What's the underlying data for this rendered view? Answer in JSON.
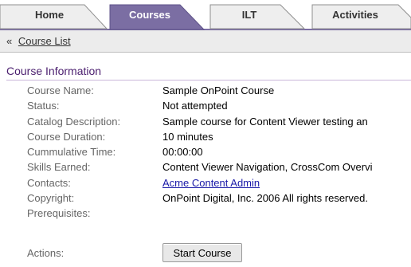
{
  "tabs": [
    {
      "label": "Home",
      "active": false
    },
    {
      "label": "Courses",
      "active": true
    },
    {
      "label": "ILT",
      "active": false
    },
    {
      "label": "Activities",
      "active": false
    }
  ],
  "breadcrumb": {
    "arrow": "«",
    "link": "Course List"
  },
  "section_title": "Course Information",
  "fields": [
    {
      "label": "Course Name:",
      "value": "Sample OnPoint Course"
    },
    {
      "label": "Status:",
      "value": "Not attempted"
    },
    {
      "label": "Catalog Description:",
      "value": "Sample course for Content Viewer testing an"
    },
    {
      "label": "Course Duration:",
      "value": "10 minutes"
    },
    {
      "label": "Cummulative Time:",
      "value": "00:00:00"
    },
    {
      "label": "Skills Earned:",
      "value": "Content Viewer Navigation, CrossCom Overvi"
    },
    {
      "label": "Contacts:",
      "value": "Acme Content Admin",
      "link": true
    },
    {
      "label": "Copyright:",
      "value": "OnPoint Digital, Inc. 2006 All rights reserved."
    },
    {
      "label": "Prerequisites:",
      "value": ""
    }
  ],
  "actions": {
    "label": "Actions:",
    "button": "Start Course"
  },
  "colors": {
    "tab_active": "#7b6ea3",
    "tab_inactive": "#eeeeee",
    "section_title": "#4b1f6f",
    "link": "#1a1aa8"
  }
}
